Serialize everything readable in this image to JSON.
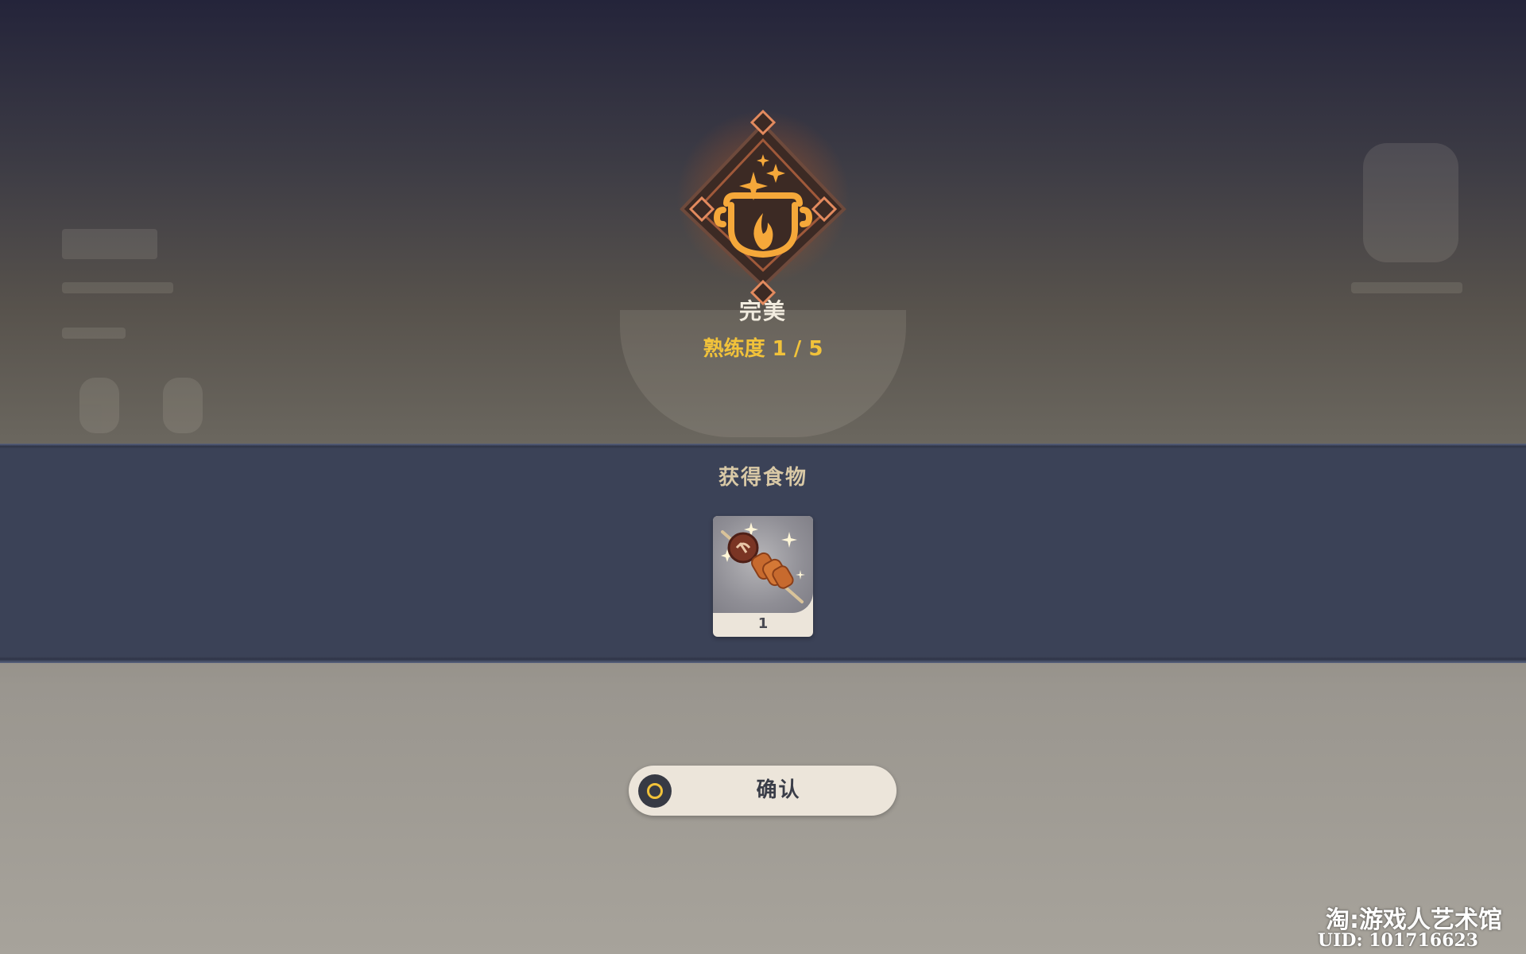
{
  "result": {
    "title": "完美",
    "proficiency": "熟练度 1 / 5",
    "emblem_icon": "cooking-pot-icon",
    "accent_color": "#f1c23a"
  },
  "rewards": {
    "title": "获得食物",
    "items": [
      {
        "icon": "skewer-food-icon",
        "count": "1"
      }
    ]
  },
  "confirm": {
    "label": "确认",
    "icon": "controller-circle-icon"
  },
  "watermark": {
    "title": "淘:游戏人艺术馆",
    "uid": "UID: 101716623"
  }
}
